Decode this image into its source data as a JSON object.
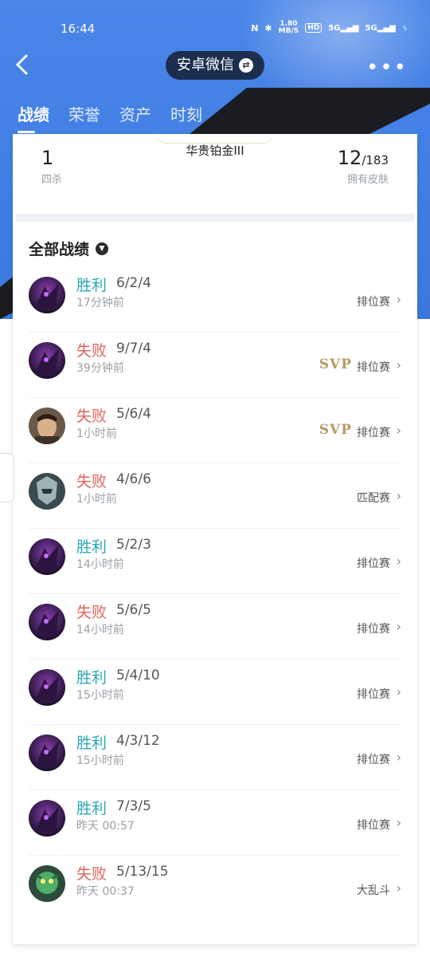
{
  "status": {
    "time": "16:44",
    "net_speed": "1.80\nMB/S",
    "hd": "HD",
    "sig1": "5G",
    "sig2": "5G"
  },
  "nav": {
    "title": "安卓微信",
    "more": "•••"
  },
  "tabs": [
    {
      "label": "战绩",
      "active": true
    },
    {
      "label": "荣誉",
      "active": false
    },
    {
      "label": "资产",
      "active": false
    },
    {
      "label": "时刻",
      "active": false
    }
  ],
  "stats": {
    "left_value": "1",
    "left_label": "四杀",
    "rank": "华贵铂金III",
    "right_value": "12",
    "right_total": "/183",
    "right_label": "拥有皮肤"
  },
  "section": {
    "title": "全部战绩"
  },
  "matches": [
    {
      "result": "胜利",
      "kda": "6/2/4",
      "time": "17分钟前",
      "svp": "",
      "mode": "排位赛",
      "win": true,
      "hero": "dark"
    },
    {
      "result": "失败",
      "kda": "9/7/4",
      "time": "39分钟前",
      "svp": "SVP",
      "mode": "排位赛",
      "win": false,
      "hero": "dark"
    },
    {
      "result": "失败",
      "kda": "5/6/4",
      "time": "1小时前",
      "svp": "SVP",
      "mode": "排位赛",
      "win": false,
      "hero": "warrior"
    },
    {
      "result": "失败",
      "kda": "4/6/6",
      "time": "1小时前",
      "svp": "",
      "mode": "匹配赛",
      "win": false,
      "hero": "armor"
    },
    {
      "result": "胜利",
      "kda": "5/2/3",
      "time": "14小时前",
      "svp": "",
      "mode": "排位赛",
      "win": true,
      "hero": "dark"
    },
    {
      "result": "失败",
      "kda": "5/6/5",
      "time": "14小时前",
      "svp": "",
      "mode": "排位赛",
      "win": false,
      "hero": "dark"
    },
    {
      "result": "胜利",
      "kda": "5/4/10",
      "time": "15小时前",
      "svp": "",
      "mode": "排位赛",
      "win": true,
      "hero": "dark"
    },
    {
      "result": "胜利",
      "kda": "4/3/12",
      "time": "15小时前",
      "svp": "",
      "mode": "排位赛",
      "win": true,
      "hero": "dark"
    },
    {
      "result": "胜利",
      "kda": "7/3/5",
      "time": "昨天 00:57",
      "svp": "",
      "mode": "排位赛",
      "win": true,
      "hero": "dark"
    },
    {
      "result": "失败",
      "kda": "5/13/15",
      "time": "昨天 00:37",
      "svp": "",
      "mode": "大乱斗",
      "win": false,
      "hero": "green"
    }
  ]
}
